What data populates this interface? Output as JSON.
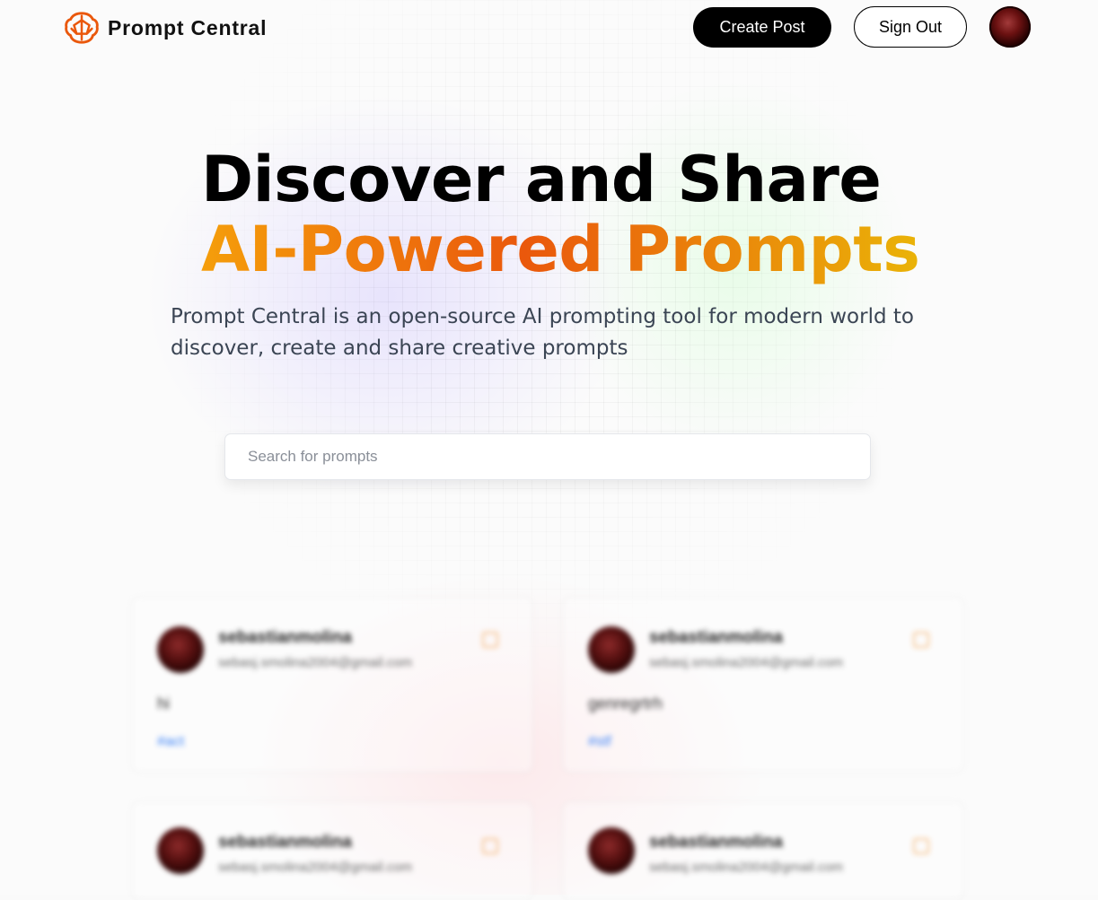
{
  "header": {
    "brand": "Prompt Central",
    "create_post_label": "Create Post",
    "sign_out_label": "Sign Out"
  },
  "hero": {
    "headline_line1": "Discover and Share",
    "headline_line2": "AI-Powered Prompts",
    "description": "Prompt Central is an open-source AI prompting tool for modern world to discover, create and share creative prompts"
  },
  "search": {
    "placeholder": "Search for prompts",
    "value": ""
  },
  "feed": {
    "cards": [
      {
        "username": "sebastianmolina",
        "email": "sebasj.smolina2004@gmail.com",
        "prompt": "hi",
        "tag": "#act"
      },
      {
        "username": "sebastianmolina",
        "email": "sebasj.smolina2004@gmail.com",
        "prompt": "genregrtrh",
        "tag": "#stf"
      },
      {
        "username": "sebastianmolina",
        "email": "sebasj.smolina2004@gmail.com",
        "prompt": "",
        "tag": ""
      },
      {
        "username": "sebastianmolina",
        "email": "sebasj.smolina2004@gmail.com",
        "prompt": "",
        "tag": ""
      }
    ]
  },
  "colors": {
    "accent_orange": "#ea580c",
    "gradient_start": "#f59e0b",
    "gradient_end": "#eab308",
    "tag_blue": "#3b82f6"
  }
}
